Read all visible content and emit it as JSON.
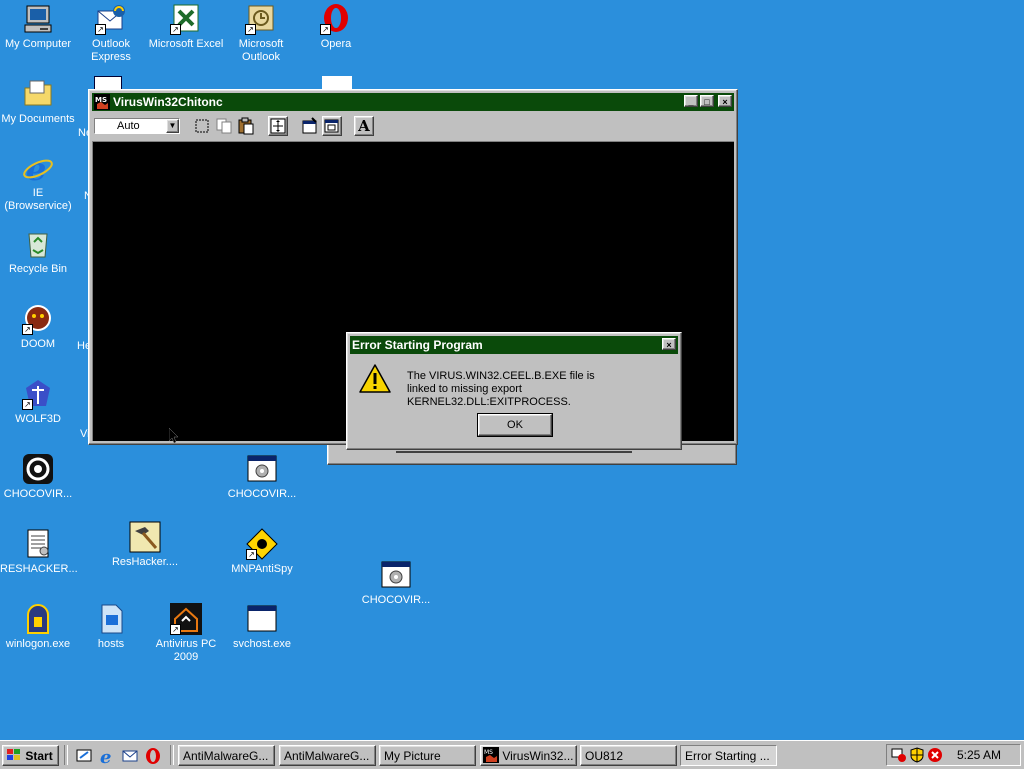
{
  "desktop": {
    "icons": [
      {
        "label": "My Computer"
      },
      {
        "label": "Outlook Express"
      },
      {
        "label": "Microsoft Excel"
      },
      {
        "label": "Microsoft Outlook"
      },
      {
        "label": "Opera"
      },
      {
        "label": "My Documents"
      },
      {
        "label": "IE (Browservice)"
      },
      {
        "label": "Recycle Bin"
      },
      {
        "label": "DOOM"
      },
      {
        "label": "WOLF3D"
      },
      {
        "label": "CHOCOVIR..."
      },
      {
        "label": "CHOCOVIR..."
      },
      {
        "label": "RESHACKER..."
      },
      {
        "label": "ResHacker...."
      },
      {
        "label": "MNPAntiSpy"
      },
      {
        "label": "CHOCOVIR..."
      },
      {
        "label": "winlogon.exe"
      },
      {
        "label": "hosts"
      },
      {
        "label": "Antivirus PC 2009"
      },
      {
        "label": "svchost.exe"
      }
    ],
    "partial_labels": [
      "Ne",
      "N",
      "He",
      "Vi"
    ]
  },
  "console_window": {
    "title": "VirusWin32Chitonc",
    "font_select": "Auto",
    "toolbar_a": "A",
    "window_buttons": {
      "minimize": "_",
      "maximize": "□",
      "close": "×"
    }
  },
  "error_dialog": {
    "title": "Error Starting Program",
    "close": "×",
    "message_line1": "The VIRUS.WIN32.CEEL.B.EXE file is",
    "message_line2": "linked to missing export KERNEL32.DLL:EXITPROCESS.",
    "ok_label": "OK",
    "icon": "warning-icon"
  },
  "taskbar": {
    "start_label": "Start",
    "quicklaunch": [
      "desktop-icon",
      "ie-icon",
      "outlook-icon",
      "opera-icon"
    ],
    "tasks": [
      {
        "label": "AntiMalwareG..."
      },
      {
        "label": "AntiMalwareG..."
      },
      {
        "label": "My Picture"
      },
      {
        "label": "VirusWin32..."
      },
      {
        "label": "OU812"
      },
      {
        "label": "Error Starting ..."
      }
    ],
    "clock": "5:25 AM"
  },
  "colors": {
    "desktop": "#2b8fdc",
    "titlebar": "#0a4a0a",
    "face": "#c0c0c0",
    "warning": "#f7d400"
  }
}
